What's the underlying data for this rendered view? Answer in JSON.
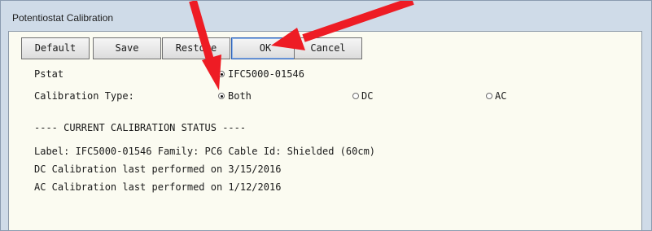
{
  "window": {
    "title": "Potentiostat Calibration"
  },
  "toolbar": {
    "default_label": "Default",
    "save_label": "Save",
    "restore_label": "Restore",
    "ok_label": "OK",
    "cancel_label": "Cancel"
  },
  "pstat": {
    "label": "Pstat",
    "value": "IFC5000-01546"
  },
  "calibration_type": {
    "label": "Calibration Type:",
    "options": [
      {
        "label": "Both",
        "checked": true
      },
      {
        "label": "DC",
        "checked": false
      },
      {
        "label": "AC",
        "checked": false
      }
    ],
    "selected": "Both"
  },
  "status": {
    "heading": "---- CURRENT CALIBRATION STATUS ----",
    "label_line": "Label: IFC5000-01546    Family: PC6    Cable Id: Shielded (60cm)",
    "dc_line": "DC Calibration last performed on 3/15/2016",
    "ac_line": "AC Calibration last performed on 1/12/2016"
  },
  "annotations": {
    "arrow_color": "#ee1c24"
  }
}
